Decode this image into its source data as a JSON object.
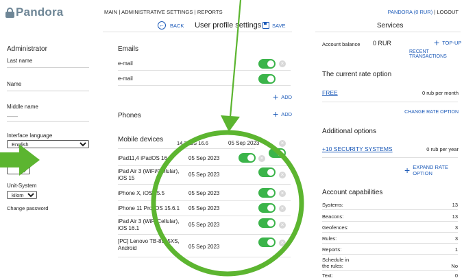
{
  "brand": {
    "name": "Pandora"
  },
  "topnav": {
    "main": "MAIN",
    "sep1": " | ",
    "admin": "ADMINISTRATIVE SETTINGS",
    "sep2": " | ",
    "reports": "REPORTS"
  },
  "account": {
    "label": "PANDORA (0 RUR)",
    "sep": " | ",
    "logout": "LOGOUT"
  },
  "toolbar": {
    "back": "BACK",
    "title": "User profile settings",
    "save": "SAVE"
  },
  "left": {
    "section": "Administrator",
    "last_name": "Last name",
    "name": "Name",
    "middle_name": "Middle name",
    "middle_value": "——",
    "interface_language": "Interface language",
    "language_value": "English",
    "timezone_partial": "e",
    "timezone_value": "",
    "unit_system": "Unit-System",
    "unit_value": "kilometr",
    "change_password": "Change password"
  },
  "emails": {
    "title": "Emails",
    "items": [
      {
        "label": "e-mail"
      },
      {
        "label": "e-mail"
      }
    ],
    "add": "ADD"
  },
  "phones": {
    "title": "Phones",
    "add": "ADD"
  },
  "mobile": {
    "title": "Mobile devices",
    "header_extra": "14,2 iOS 16.6",
    "header_date": "05 Sep 2023",
    "rows": [
      {
        "device": "iPad11,4 iPadOS 16.2",
        "date": "05 Sep 2023"
      },
      {
        "device": "iPad Air 3 (WiFi/Cellular), iOS 15",
        "date": "05 Sep 2023"
      },
      {
        "device": "iPhone X, iOS 15.5",
        "date": "05 Sep 2023"
      },
      {
        "device": "iPhone 11 Pro iOS 15.6.1",
        "date": "05 Sep 2023"
      },
      {
        "device": "iPad Air 3 (WiFi/Cellular), iOS 16.1",
        "date": "05 Sep 2023"
      },
      {
        "device": "[PC] Lenovo TB-8505XS, Android",
        "date": "05 Sep 2023"
      }
    ]
  },
  "services": {
    "title": "Services",
    "balance_label": "Account balance",
    "balance_value": "0 RUR",
    "topup": "TOP-UP",
    "recent": "RECENT TRANSACTIONS",
    "rate_title": "The current rate option",
    "rate_name": "FREE",
    "rate_price": "0 rub per month",
    "change_rate": "CHANGE RATE OPTION",
    "additional_title": "Additional options",
    "option_name": "+10 SECURITY SYSTEMS",
    "option_price": "0 rub per year",
    "expand_rate": "EXPAND RATE OPTION",
    "capabilities_title": "Account capabilities",
    "capabilities": [
      {
        "label": "Systems:",
        "value": "13"
      },
      {
        "label": "Beacons:",
        "value": "13"
      },
      {
        "label": "Geofences:",
        "value": "3"
      },
      {
        "label": "Rules:",
        "value": "3"
      },
      {
        "label": "Reports:",
        "value": "1"
      },
      {
        "label": "Schedule in the rules:",
        "value": "No"
      },
      {
        "label": "Text:",
        "value": "0"
      }
    ]
  },
  "colors": {
    "accent": "#1c5ab8",
    "toggle_on": "#3bb44a",
    "annotation": "#5cb530"
  }
}
